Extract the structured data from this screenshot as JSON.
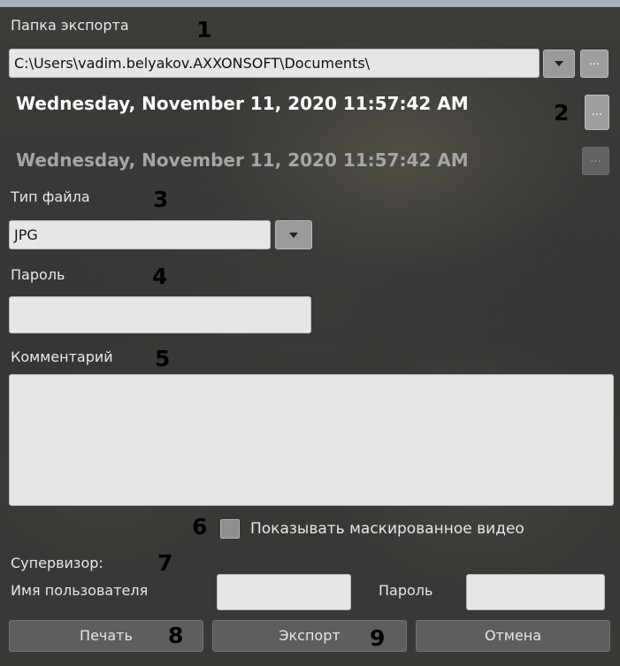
{
  "export_folder": {
    "label": "Папка экспорта",
    "path": "C:\\Users\\vadim.belyakov.AXXONSOFT\\Documents\\",
    "browse_label": "..."
  },
  "dates": {
    "start": "Wednesday, November 11, 2020 11:57:42 AM",
    "end": "Wednesday, November 11, 2020 11:57:42 AM",
    "button_label": "..."
  },
  "file_type": {
    "label": "Тип файла",
    "value": "JPG"
  },
  "password": {
    "label": "Пароль",
    "value": ""
  },
  "comment": {
    "label": "Комментарий",
    "value": ""
  },
  "masked_video": {
    "label": "Показывать маскированное видео",
    "checked": false
  },
  "supervisor": {
    "label": "Супервизор:",
    "username_label": "Имя пользователя",
    "username_value": "",
    "password_label": "Пароль",
    "password_value": ""
  },
  "buttons": {
    "print": "Печать",
    "export": "Экспорт",
    "cancel": "Отмена"
  },
  "callouts": [
    "1",
    "2",
    "3",
    "4",
    "5",
    "6",
    "7",
    "8",
    "9"
  ]
}
